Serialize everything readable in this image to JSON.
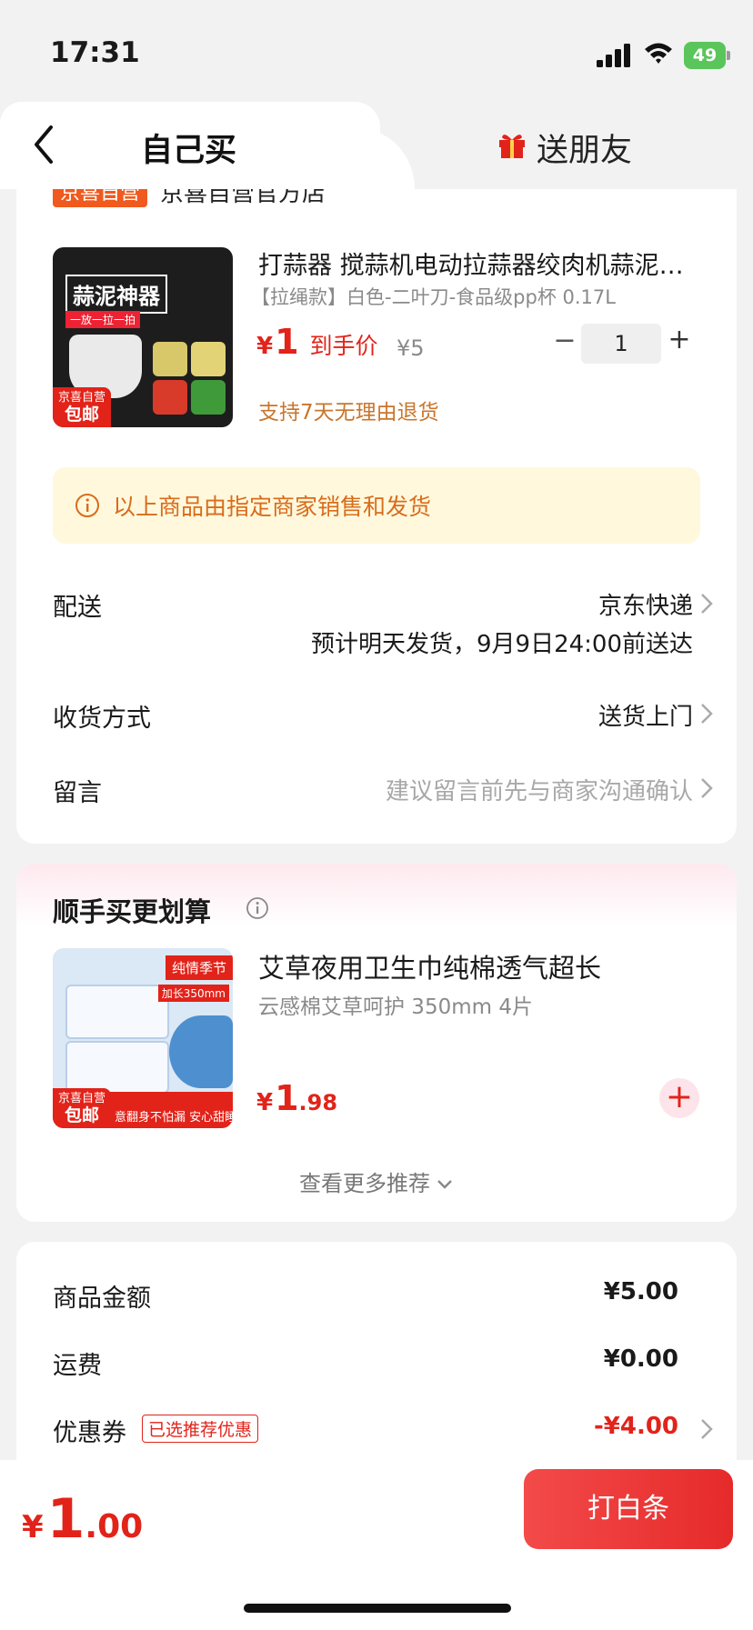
{
  "status_bar": {
    "time": "17:31",
    "battery": "49"
  },
  "tabs": {
    "self": "自己买",
    "friend": "送朋友"
  },
  "store": {
    "badge": "京喜自营",
    "name": "京喜自营官方店"
  },
  "product": {
    "image_title": "蒜泥神器",
    "image_subtitle": "一放一拉一拍",
    "image_badge_top": "京喜自营",
    "image_badge_bottom": "包邮",
    "title": "打蒜器 搅蒜机电动拉蒜器绞肉机蒜泥神器",
    "spec": "【拉绳款】白色-二叶刀-食品级pp杯 0.17L",
    "price_symbol": "¥",
    "price": "1",
    "price_label": "到手价",
    "original_price": "¥5",
    "quantity": "1",
    "return_policy": "支持7天无理由退货"
  },
  "notice": "以上商品由指定商家销售和发货",
  "shipping": {
    "label": "配送",
    "value": "京东快递",
    "eta": "预计明天发货，9月9日24:00前送达"
  },
  "receive": {
    "label": "收货方式",
    "value": "送货上门"
  },
  "message": {
    "label": "留言",
    "placeholder": "建议留言前先与商家沟通确认"
  },
  "recommend": {
    "title": "顺手买更划算",
    "image_tag": "纯情季节",
    "image_len": "加长350mm",
    "image_badge_top": "京喜自营",
    "image_badge_bottom": "包邮",
    "image_slogan": "意翻身不怕漏 安心甜睡",
    "name": "艾草夜用卫生巾纯棉透气超长",
    "spec": "云感棉艾草呵护 350mm 4片",
    "price_symbol": "¥",
    "price_int": "1",
    "price_dec": ".98",
    "add": "+",
    "see_more": "查看更多推荐"
  },
  "summary": {
    "goods_label": "商品金额",
    "goods_value": "¥5.00",
    "freight_label": "运费",
    "freight_value": "¥0.00",
    "coupon_label": "优惠券",
    "coupon_tag": "已选推荐优惠",
    "coupon_value": "-¥4.00"
  },
  "bottom": {
    "total_symbol": "¥",
    "total_int": "1",
    "total_dec": ".00",
    "pay_button": "打白条"
  },
  "colors": {
    "accent": "#e2231a",
    "notice_bg": "#fff8dc",
    "notice_text": "#d96c1c"
  }
}
